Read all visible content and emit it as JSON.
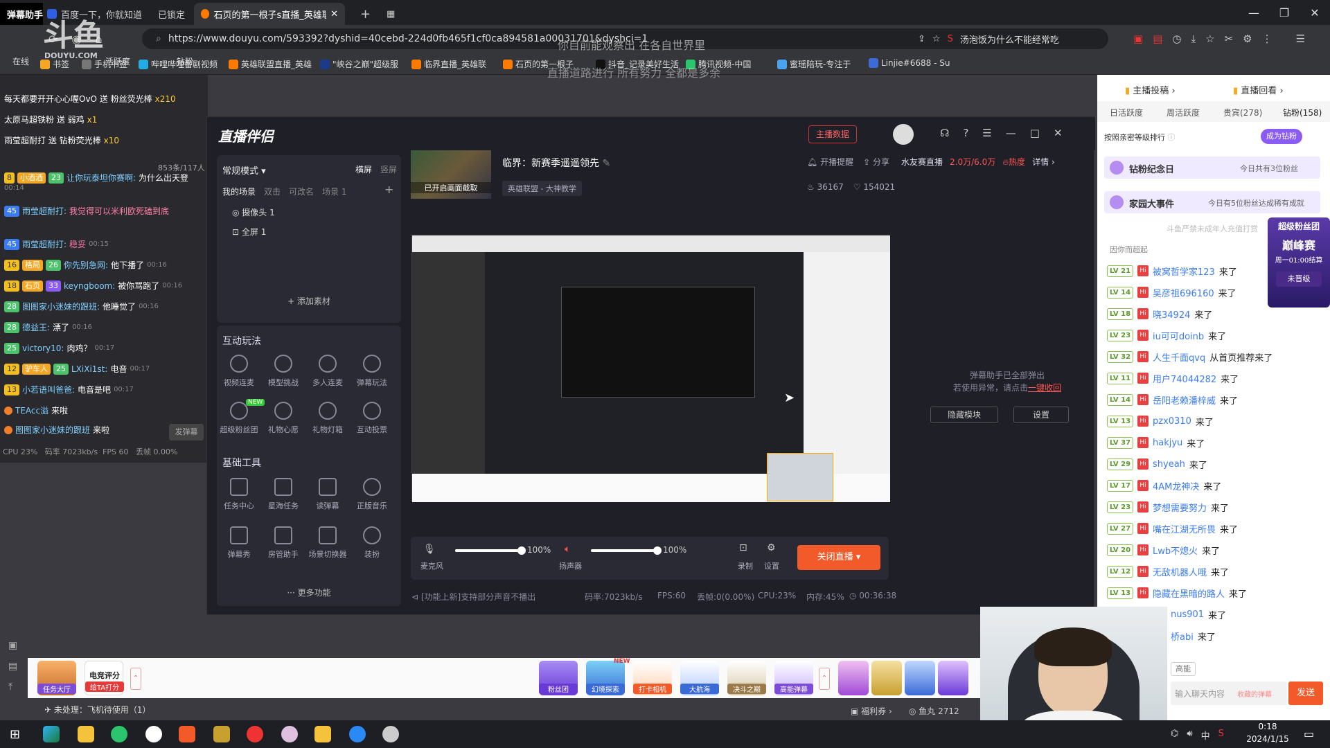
{
  "browser": {
    "tabs": [
      {
        "label": "弹幕助手"
      },
      {
        "label": "百度一下，你就知道"
      },
      {
        "label": "已锁定"
      },
      {
        "label": "石页的第一根子s直播_英雄联盟",
        "active": true
      }
    ],
    "new_tab": "+",
    "url": "https://www.douyu.com/593392?dyshid=40cebd-224d0fb465f1cf0ca894581a00031701&dyshci=1",
    "search_suggestion": "汤泡饭为什么不能经常吃",
    "overlay_text_1": "你目前能观察出 在各自世界里",
    "overlay_text_2": "直播道路进行 所有努力 全都是多余",
    "bookmarks": [
      "书签",
      "手机书签",
      "哔哩哔哩番剧视频",
      "英雄联盟直播_英雄",
      "\"峡谷之巅\"超级服",
      "临界直播_英雄联",
      "石页的第一根子",
      "抖音_记录美好生活",
      "腾讯视频-中国",
      "蜜瑶陪玩-专注于",
      "Linjie#6688 - Su"
    ]
  },
  "douyu": {
    "logo": "斗鱼",
    "logo_sub": "DOUYU.COM",
    "left_labels": [
      "在线",
      "活跃度",
      "钻粉"
    ]
  },
  "left_chat": {
    "messages": [
      {
        "text": "每天都要开开心心喔OvO 送 粉丝荧光棒",
        "count": "x210"
      },
      {
        "text": "太原马超铁粉 送 弱鸡",
        "count": "x1"
      },
      {
        "text": "雨莹超耐打 送 钻粉荧光棒",
        "count": "x10"
      }
    ],
    "viewer_count": "853条/117人",
    "chats": [
      {
        "lv": "8",
        "fan": "小酒酒",
        "lv2": "23",
        "name": "让你玩泰坦你赛啊:",
        "msg": "为什么出天登",
        "time": "00:14"
      },
      {
        "lv": "45",
        "name": "雨莹超耐打:",
        "msg": "我觉得可以米利欧死磕到底",
        "time": ""
      },
      {
        "lv": "45",
        "name": "雨莹超耐打:",
        "msg": "稳妥",
        "time": "00:15"
      },
      {
        "lv": "16",
        "fan": "格局",
        "lv2": "26",
        "name": "你先别急网:",
        "msg": "他下播了",
        "time": "00:16"
      },
      {
        "lv": "18",
        "fan": "石页",
        "lv2": "33",
        "name": "keyngboom:",
        "msg": "被你骂跑了",
        "time": "00:16"
      },
      {
        "lv2": "28",
        "name": "图图家小迷妹的跟班:",
        "msg": "他睡觉了",
        "time": "00:16"
      },
      {
        "lv2": "28",
        "name": "德益王:",
        "msg": "漂了",
        "time": "00:16"
      },
      {
        "lv2": "25",
        "name": "victory10:",
        "msg": "肉鸡？",
        "time": "00:17"
      },
      {
        "lv": "12",
        "fan": "驴车人",
        "lv2": "25",
        "name": "LXiXi1st:",
        "msg": "电音",
        "time": "00:17"
      },
      {
        "lv2": "13",
        "name": "小若语叫爸爸:",
        "msg": "电音是吧",
        "time": "00:17"
      },
      {
        "name": "TEAcc溢",
        "msg": "来啦",
        "time": ""
      },
      {
        "name": "图图家小迷妹的跟班",
        "msg": "来啦",
        "time": ""
      }
    ],
    "send_button": "发弹幕",
    "perf": "CPU 23%   码率 7023kb/s  FPS 60   丢帧 0.00%"
  },
  "app": {
    "title": "直播伴侣",
    "anchor_data": "主播数据",
    "mode": "常规模式",
    "orient_h": "横屏",
    "orient_v": "竖屏",
    "scene_tabs": [
      "我的场景",
      "双击",
      "可改名",
      "场景 1"
    ],
    "scene_add": "+",
    "sources": [
      "摄像头 1",
      "全屏 1"
    ],
    "add_source": "+ 添加素材",
    "interactive_title": "互动玩法",
    "interactive": [
      "视频连麦",
      "模型挑战",
      "多人连麦",
      "弹幕玩法",
      "超级粉丝团",
      "礼物心愿",
      "礼物灯箱",
      "互动投票"
    ],
    "new_tag": "NEW",
    "tools_title": "基础工具",
    "tools": [
      "任务中心",
      "星海任务",
      "读弹幕",
      "正版音乐",
      "弹幕秀",
      "房管助手",
      "场景切换器",
      "装扮"
    ],
    "more": "··· 更多功能",
    "thumb_caption": "已开启画面截取",
    "stream_title": "临界：新赛季遥遥领先",
    "category": "英雄联盟 - 大神教学",
    "remind": "开播提醒",
    "share": "分享",
    "likes": "36167",
    "hearts": "154021",
    "water_label": "水友赛直播",
    "water_value": "2.0万/6.0万",
    "hot": "热度",
    "detail": "详情",
    "danmu_notice_1": "弹幕助手已全部弹出",
    "danmu_notice_2": "若使用异常，请点击",
    "danmu_notice_link": "一键收回",
    "hide_module": "隐藏模块",
    "settings": "设置",
    "mic_label": "麦克风",
    "mic_level": 1.0,
    "mic_value": "100%",
    "speaker_label": "扬声器",
    "speaker_level": 1.0,
    "speaker_value": "100%",
    "record": "录制",
    "setting_label": "设置",
    "end_live": "关闭直播",
    "status_notice": "[功能上新]支持部分声音不播出",
    "bitrate": "码率:7023kb/s",
    "fps": "FPS:60",
    "drop": "丢帧:0(0.00%)",
    "cpu": "CPU:23%",
    "mem": "内存:45%",
    "duration": "00:36:38"
  },
  "right": {
    "header_btn1": "主播投稿",
    "header_btn2": "直播回看",
    "tabs": [
      "日活跃度",
      "周活跃度",
      "贵宾(278)",
      "钻粉(158)"
    ],
    "sort_label": "按照亲密等级排行",
    "become_fan": "成为钻粉",
    "banner1": "钻粉纪念日",
    "banner1_sub": "今日共有3位粉丝",
    "banner2": "家园大事件",
    "banner2_sub": "今日有5位粉丝达成稀有成就",
    "notice": "斗鱼严禁未成年人充值打赏",
    "rank_label": "因你而超起",
    "rank_tag_1": "超级粉丝团",
    "rank_tag_2": "巅峰赛",
    "rank_tag_3": "周一01:00结算",
    "rank_tag_4": "未晋级",
    "viewers": [
      {
        "lv": "21",
        "name": "被窝哲学家123",
        "act": "来了"
      },
      {
        "lv": "14",
        "name": "吴彦祖696160",
        "act": "来了"
      },
      {
        "lv": "18",
        "name": "晓34924",
        "act": "来了"
      },
      {
        "lv": "23",
        "name": "iu可可doinb",
        "act": "来了"
      },
      {
        "lv": "32",
        "name": "人生千面qvq",
        "act": "从首页推荐来了"
      },
      {
        "lv": "11",
        "name": "用户74044282",
        "act": "来了"
      },
      {
        "lv": "14",
        "name": "岳阳老赖潘梓威",
        "act": "来了"
      },
      {
        "lv": "13",
        "name": "pzx0310",
        "act": "来了"
      },
      {
        "lv": "37",
        "name": "hakjyu",
        "act": "来了"
      },
      {
        "lv": "29",
        "name": "shyeah",
        "act": "来了"
      },
      {
        "lv": "17",
        "name": "4AM龙神决",
        "act": "来了"
      },
      {
        "lv": "23",
        "name": "梦想需要努力",
        "act": "来了"
      },
      {
        "lv": "27",
        "name": "嘴在江湖无所畏",
        "act": "来了"
      },
      {
        "lv": "20",
        "name": "Lwb不熄火",
        "act": "来了"
      },
      {
        "lv": "12",
        "name": "无敌机器人哦",
        "act": "来了"
      },
      {
        "lv": "13",
        "name": "隐藏在黑暗的路人",
        "act": "来了"
      },
      {
        "name": "nus901",
        "act": "来了"
      },
      {
        "name": "桥abi",
        "act": "来了"
      }
    ],
    "chat_placeholder": "输入聊天内容",
    "collect_danmu": "收藏的弹幕",
    "send": "发送",
    "high_tag": "高能"
  },
  "bottom": {
    "task_hall": "任务大厅",
    "esports": "电竞评分",
    "esports_sub": "给TA打分",
    "unhandled": "未处理：飞机待使用（1）",
    "gifts": [
      "粉丝团",
      "幻境探索",
      "打卡相机",
      "大航海",
      "决斗之巅",
      "高能弹幕"
    ],
    "gift_new": "NEW",
    "welfare": "福利券",
    "fishball": "鱼丸 2712"
  },
  "taskbar": {
    "time": "0:18",
    "date": "2024/1/15",
    "ime": "中"
  }
}
